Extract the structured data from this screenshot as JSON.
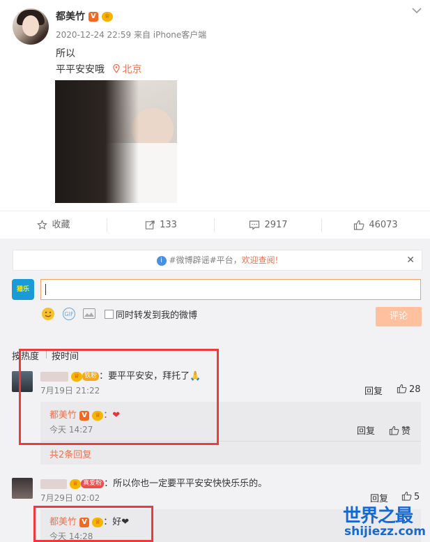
{
  "post": {
    "username": "都美竹",
    "v_badge": "V",
    "crown_badge": "♕",
    "timestamp": "2020-12-24 22:59",
    "source": "来自 iPhone客户端",
    "line1": "所以",
    "line2": "平平安安哦",
    "location": "北京"
  },
  "actions": {
    "favorite": "收藏",
    "repost": "133",
    "comment": "2917",
    "like": "46073"
  },
  "notice": {
    "prefix": "#微博辟谣#平台，",
    "link": "欢迎查阅!"
  },
  "composer": {
    "avatar_text": "猎乐",
    "checkbox_label": "同时转发到我的微博",
    "submit": "评论"
  },
  "sort": {
    "hot": "按热度",
    "time": "按时间"
  },
  "comments": [
    {
      "fan_badge": "铁粉",
      "text": "：要平平安安，拜托了🙏",
      "time": "7月19日 21:22",
      "reply": "回复",
      "likes": "28",
      "sub": {
        "author": "都美竹",
        "text": "：❤",
        "time": "今天 14:27",
        "reply": "回复",
        "like": "赞"
      },
      "more": "共2条回复"
    },
    {
      "fan_badge": "真爱粉",
      "text": "：所以你也一定要平平安安快快乐乐的。",
      "time": "7月29日 02:02",
      "reply": "回复",
      "likes": "5",
      "sub": {
        "author": "都美竹",
        "text": "：好❤",
        "time": "今天 14:28"
      }
    }
  ],
  "watermark": {
    "title": "世界之最",
    "url": "shijiezz.com"
  },
  "colors": {
    "accent": "#eb7350",
    "highlight": "#f03a3a",
    "panel": "#f2f2f5"
  }
}
